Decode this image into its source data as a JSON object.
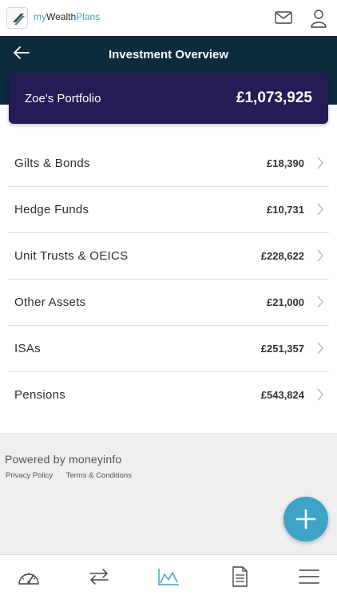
{
  "app": {
    "logo": {
      "my": "my",
      "wealth": "Wealth",
      "plans": "Plans"
    },
    "icons": {
      "mail": "mail-icon",
      "user": "user-icon"
    }
  },
  "header": {
    "title": "Investment Overview",
    "back_icon": "arrow-left-icon"
  },
  "portfolio": {
    "name": "Zoe's Portfolio",
    "total": "£1,073,925",
    "card_color": "#231c55"
  },
  "assets": [
    {
      "label": "Gilts & Bonds",
      "value": "£18,390"
    },
    {
      "label": "Hedge Funds",
      "value": "£10,731"
    },
    {
      "label": "Unit Trusts & OEICS",
      "value": "£228,622"
    },
    {
      "label": "Other Assets",
      "value": "£21,000"
    },
    {
      "label": "ISAs",
      "value": "£251,357"
    },
    {
      "label": "Pensions",
      "value": "£543,824"
    }
  ],
  "footer": {
    "powered_by": "Powered by moneyinfo",
    "privacy": "Privacy Policy",
    "terms": "Terms & Conditions"
  },
  "fab": {
    "icon": "plus-icon",
    "color": "#3ea3c8"
  },
  "bottom_nav": [
    {
      "name": "dashboard",
      "icon": "speedometer-icon",
      "active": false
    },
    {
      "name": "transfers",
      "icon": "swap-arrows-icon",
      "active": false
    },
    {
      "name": "investments",
      "icon": "area-chart-icon",
      "active": true
    },
    {
      "name": "documents",
      "icon": "document-icon",
      "active": false
    },
    {
      "name": "menu",
      "icon": "hamburger-menu-icon",
      "active": false
    }
  ],
  "colors": {
    "header": "#0c2b3b",
    "accent": "#3ea3c8",
    "active_nav": "#3ea3c8"
  }
}
